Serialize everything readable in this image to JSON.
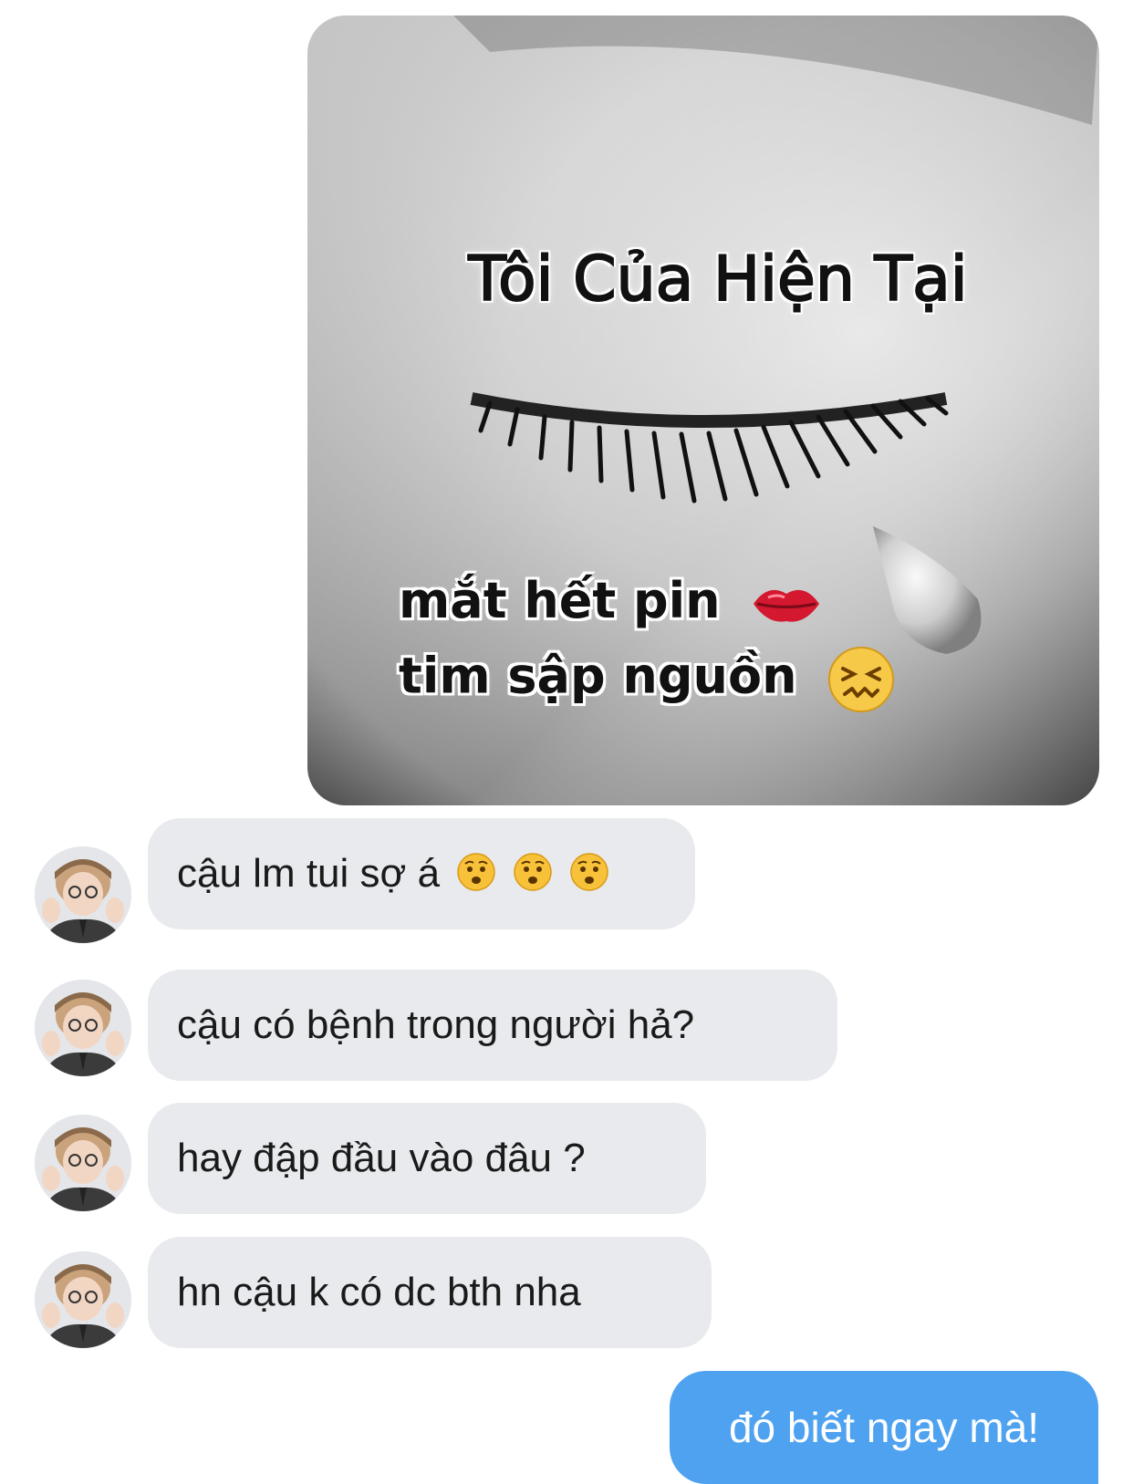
{
  "meme_image": {
    "title": "Tôi Của Hiện Tại",
    "line1": "mắt hết pin",
    "line2": "tim sập nguồn",
    "line1_icon": "lips-icon",
    "line2_icon": "confounded-face-icon"
  },
  "received_messages": [
    {
      "text": "cậu lm tui sợ á",
      "icons": [
        "worried-face-icon",
        "worried-face-icon",
        "worried-face-icon"
      ]
    },
    {
      "text": "cậu có bệnh trong người hả?"
    },
    {
      "text": "hay đập đầu vào đâu ?"
    },
    {
      "text": "hn cậu k có dc bth nha"
    }
  ],
  "sent_message": {
    "text": "đó biết ngay mà!"
  },
  "colors": {
    "received_bubble": "#e8eaed",
    "sent_bubble": "#4ea2f0",
    "background": "#ffffff"
  }
}
